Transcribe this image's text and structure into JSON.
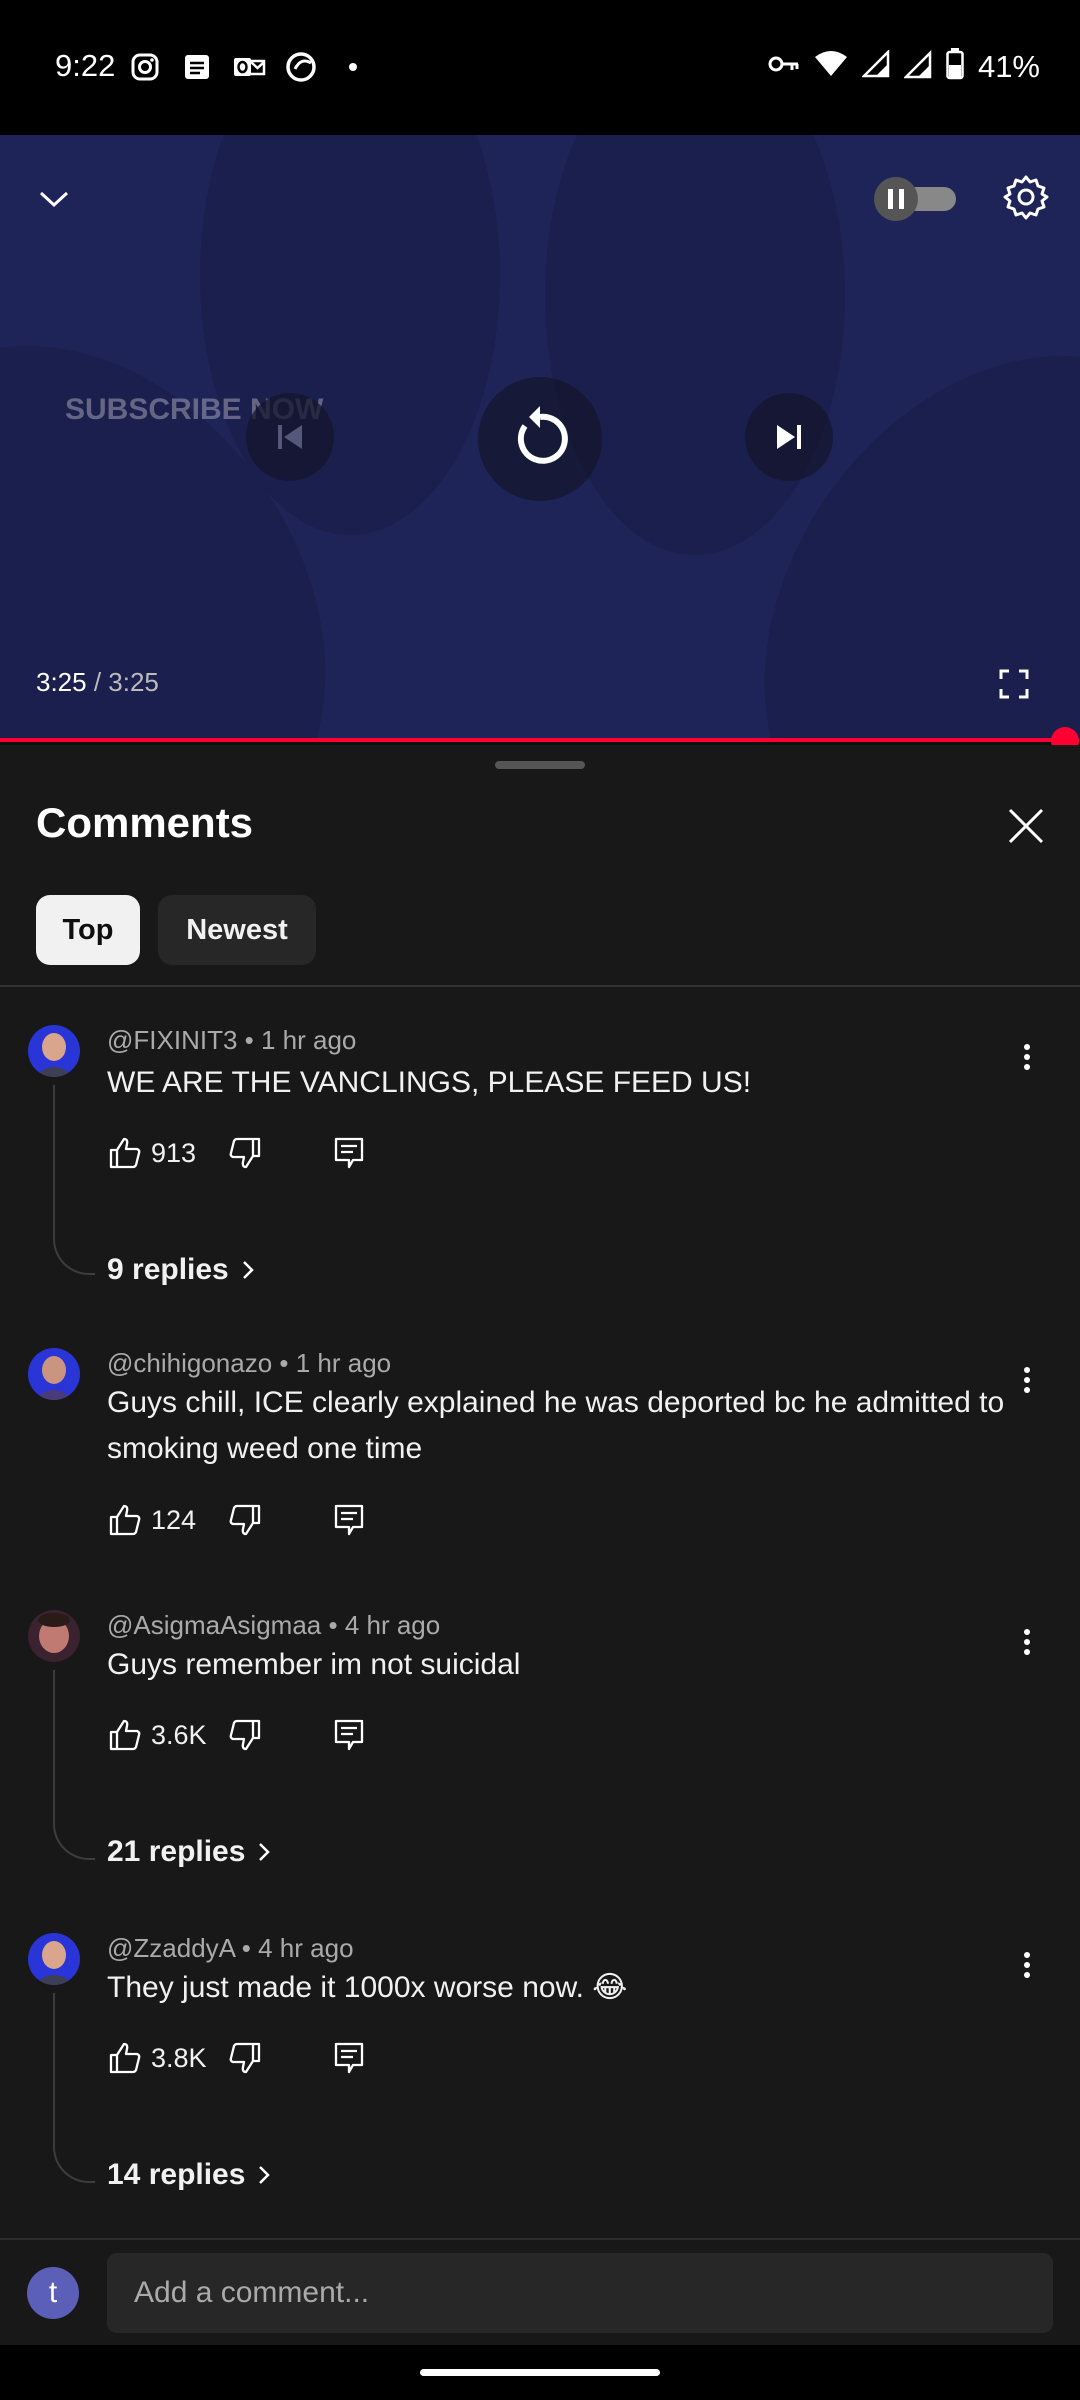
{
  "status_bar": {
    "time": "9:22",
    "battery": "41%",
    "icons": [
      "instagram-icon",
      "tasks-icon",
      "outlook-icon",
      "app-icon",
      "dot-icon",
      "vpn-key-icon",
      "wifi-icon",
      "signal-icon",
      "signal-roaming-icon",
      "battery-icon"
    ]
  },
  "player": {
    "watermark": "SUBSCRIBE NOW",
    "current_time": "3:25",
    "separator": " / ",
    "duration": "3:25",
    "progress": 1.0,
    "autoplay": "paused"
  },
  "comments_panel": {
    "title": "Comments",
    "chips": [
      {
        "label": "Top",
        "selected": true
      },
      {
        "label": "Newest",
        "selected": false
      }
    ],
    "comments": [
      {
        "author": "@FIXINIT3",
        "time": "1 hr ago",
        "text": "WE ARE THE VANCLINGS, PLEASE FEED US!",
        "likes": "913",
        "replies": "9 replies"
      },
      {
        "author": "@chihigonazo",
        "time": "1 hr ago",
        "text": "Guys chill, ICE clearly explained he was deported bc he admitted to smoking weed one time",
        "likes": "124",
        "replies": ""
      },
      {
        "author": "@AsigmaAsigmaa",
        "time": "4 hr ago",
        "text": "Guys remember im not suicidal",
        "likes": "3.6K",
        "replies": "21 replies"
      },
      {
        "author": "@ZzaddyA",
        "time": "4 hr ago",
        "text": "They just made it 1000x worse now. 😂",
        "likes": "3.8K",
        "replies": "14 replies"
      }
    ]
  },
  "composer": {
    "avatar_letter": "t",
    "placeholder": "Add a comment..."
  },
  "colors": {
    "accent": "#ff0033",
    "player_bg": "#1e2458",
    "panel_bg": "#181818"
  }
}
